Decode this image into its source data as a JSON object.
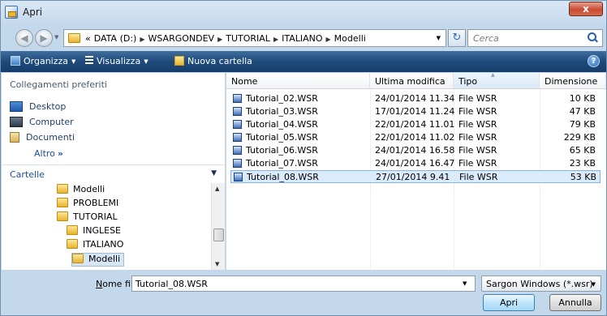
{
  "window": {
    "title": "Apri",
    "close_label": "x"
  },
  "address": {
    "crumb_prefix": "«",
    "crumbs": [
      "DATA (D:)",
      "WSARGONDEV",
      "TUTORIAL",
      "ITALIANO",
      "Modelli"
    ],
    "separator": "▶",
    "dropdown": "▼"
  },
  "search": {
    "placeholder": "Cerca"
  },
  "toolbar": {
    "organize": "Organizza",
    "view": "Visualizza",
    "new_folder": "Nuova cartella",
    "caret": "▼",
    "help": "?"
  },
  "favorites": {
    "header": "Collegamenti preferiti",
    "items": [
      {
        "label": "Desktop",
        "icon": "desktop-icon"
      },
      {
        "label": "Computer",
        "icon": "computer-icon"
      },
      {
        "label": "Documenti",
        "icon": "documents-icon"
      }
    ],
    "more": "Altro",
    "more_glyph": "»"
  },
  "folders": {
    "header": "Cartelle",
    "caret": "▼",
    "tree": [
      {
        "label": "Modelli",
        "indent": 1
      },
      {
        "label": "PROBLEMI",
        "indent": 1
      },
      {
        "label": "TUTORIAL",
        "indent": 1
      },
      {
        "label": "INGLESE",
        "indent": 2
      },
      {
        "label": "ITALIANO",
        "indent": 2
      },
      {
        "label": "Modelli",
        "indent": 3,
        "selected": true
      }
    ]
  },
  "columns": {
    "name": "Nome",
    "modified": "Ultima modifica",
    "type": "Tipo",
    "size": "Dimensione"
  },
  "files": [
    {
      "name": "Tutorial_02.WSR",
      "modified": "24/01/2014 11.34",
      "type": "File WSR",
      "size": "10 KB"
    },
    {
      "name": "Tutorial_03.WSR",
      "modified": "17/01/2014 11.24",
      "type": "File WSR",
      "size": "47 KB"
    },
    {
      "name": "Tutorial_04.WSR",
      "modified": "22/01/2014 11.01",
      "type": "File WSR",
      "size": "79 KB"
    },
    {
      "name": "Tutorial_05.WSR",
      "modified": "22/01/2014 11.02",
      "type": "File WSR",
      "size": "229 KB"
    },
    {
      "name": "Tutorial_06.WSR",
      "modified": "24/01/2014 16.58",
      "type": "File WSR",
      "size": "65 KB"
    },
    {
      "name": "Tutorial_07.WSR",
      "modified": "24/01/2014 16.47",
      "type": "File WSR",
      "size": "23 KB"
    },
    {
      "name": "Tutorial_08.WSR",
      "modified": "27/01/2014 9.41",
      "type": "File WSR",
      "size": "53 KB",
      "selected": true
    }
  ],
  "footer": {
    "filename_label_prefix": "N",
    "filename_label_rest": "ome file:",
    "filename_value": "Tutorial_08.WSR",
    "filetype": "Sargon Windows (*.wsr)",
    "open_label": "Apri",
    "cancel_label": "Annulla"
  }
}
